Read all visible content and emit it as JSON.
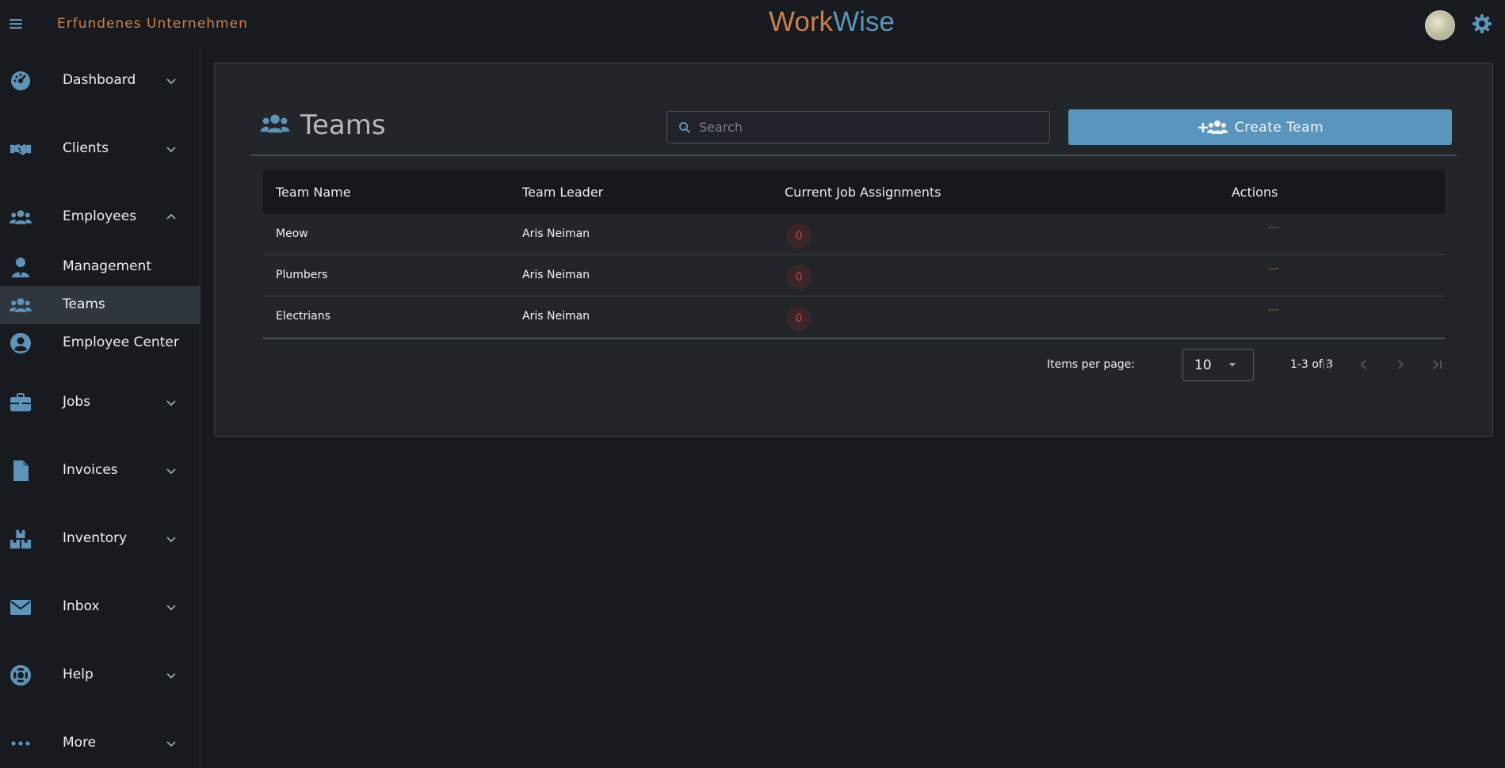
{
  "header": {
    "company": "Erfundenes Unternehmen",
    "brand_part1": "Work",
    "brand_part2": "Wise"
  },
  "sidebar": {
    "items": [
      {
        "label": "Dashboard",
        "icon": "dashboard-gauge-icon",
        "expand": "down"
      },
      {
        "label": "Clients",
        "icon": "handshake-icon",
        "expand": "down"
      },
      {
        "label": "Employees",
        "icon": "users-icon",
        "expand": "up"
      },
      {
        "label": "Management",
        "icon": "user-tie-icon"
      },
      {
        "label": "Teams",
        "icon": "users-icon",
        "active": true
      },
      {
        "label": "Employee Center",
        "icon": "user-circle-icon"
      },
      {
        "label": "Jobs",
        "icon": "briefcase-icon",
        "expand": "down"
      },
      {
        "label": "Invoices",
        "icon": "file-icon",
        "expand": "down"
      },
      {
        "label": "Inventory",
        "icon": "boxes-icon",
        "expand": "down"
      },
      {
        "label": "Inbox",
        "icon": "envelope-icon",
        "expand": "down"
      },
      {
        "label": "Help",
        "icon": "life-ring-icon",
        "expand": "down"
      },
      {
        "label": "More",
        "icon": "ellipsis-icon",
        "expand": "down"
      }
    ]
  },
  "main": {
    "title": "Teams",
    "search_placeholder": "Search",
    "create_label": "Create Team",
    "table": {
      "headers": [
        "Team Name",
        "Team Leader",
        "Current Job Assignments",
        "Actions"
      ],
      "rows": [
        {
          "name": "Meow",
          "leader": "Aris Neiman",
          "jobs": "0",
          "actions": "···"
        },
        {
          "name": "Plumbers",
          "leader": "Aris Neiman",
          "jobs": "0",
          "actions": "···"
        },
        {
          "name": "Electrians",
          "leader": "Aris Neiman",
          "jobs": "0",
          "actions": "···"
        }
      ]
    },
    "paginator": {
      "items_per_page_label": "Items per page:",
      "page_size": "10",
      "range_label": "1-3 of 3"
    }
  },
  "colors": {
    "accent_blue": "#5a95be",
    "accent_orange": "#d0814a",
    "background": "#171b1f",
    "card": "#22262b"
  }
}
